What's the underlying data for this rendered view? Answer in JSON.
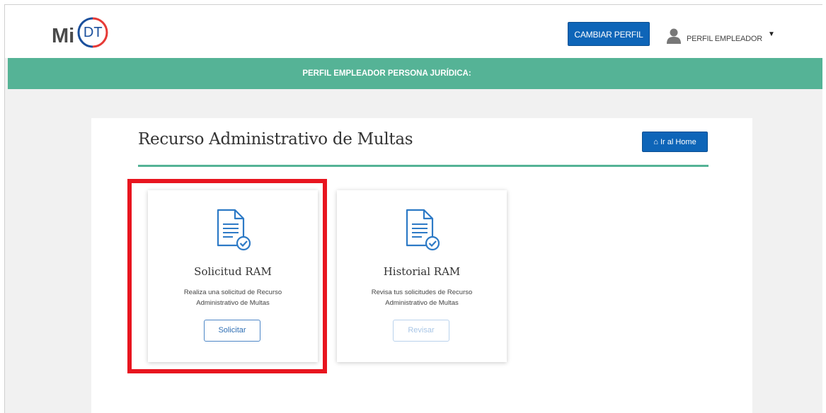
{
  "header": {
    "logo_mi": "Mi",
    "logo_dt": "DT",
    "cambiar_perfil_label": "CAMBIAR PERFIL",
    "user_label": "PERFIL EMPLEADOR",
    "user_icon": "user-icon",
    "caret_icon": "caret-down-icon"
  },
  "banner": {
    "text": "PERFIL EMPLEADOR PERSONA JURÍDICA:"
  },
  "page": {
    "title": "Recurso Administrativo de Multas",
    "home_button_label": "Ir al Home",
    "home_icon": "home-icon"
  },
  "cards": [
    {
      "title": "Solicitud RAM",
      "description": "Realiza una solicitud de Recurso Administrativo de Multas",
      "button_label": "Solicitar",
      "icon": "document-check-icon",
      "enabled": true
    },
    {
      "title": "Historial RAM",
      "description": "Revisa tus solicitudes de Recurso Administrativo de Multas",
      "button_label": "Revisar",
      "icon": "document-check-icon",
      "enabled": false
    }
  ],
  "colors": {
    "brand_blue": "#0e65b8",
    "brand_green": "#55b396",
    "highlight_red": "#e8151f",
    "logo_red": "#e63a36"
  }
}
